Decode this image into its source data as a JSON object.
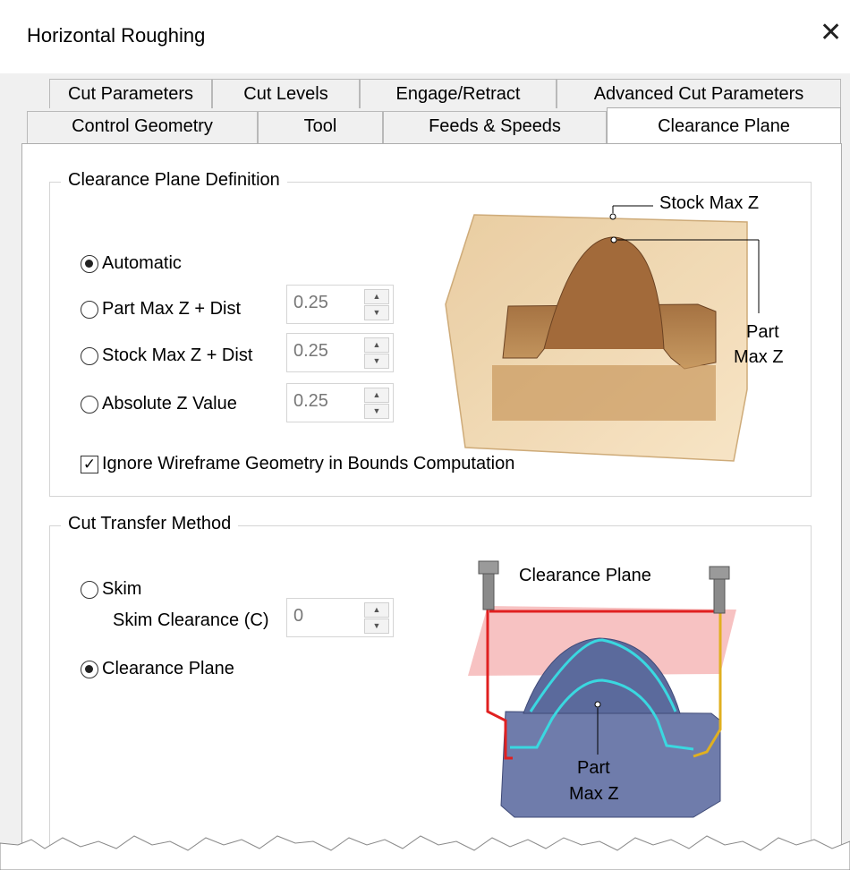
{
  "window": {
    "title": "Horizontal Roughing",
    "close_glyph": "✕"
  },
  "tabs": {
    "row1": [
      "Cut Parameters",
      "Cut Levels",
      "Engage/Retract",
      "Advanced Cut Parameters"
    ],
    "row2": [
      "Control Geometry",
      "Tool",
      "Feeds & Speeds",
      "Clearance Plane"
    ],
    "active": "Clearance Plane"
  },
  "clearance_plane_definition": {
    "group_label": "Clearance Plane Definition",
    "options": [
      {
        "label": "Automatic",
        "selected": true
      },
      {
        "label": "Part Max Z + Dist",
        "selected": false,
        "value": "0.25"
      },
      {
        "label": "Stock Max Z + Dist",
        "selected": false,
        "value": "0.25"
      },
      {
        "label": "Absolute Z Value",
        "selected": false,
        "value": "0.25"
      }
    ],
    "ignore_wireframe": {
      "label": "Ignore Wireframe Geometry in Bounds Computation",
      "checked": true
    },
    "diagram": {
      "stock_max_z": "Stock Max Z",
      "part_max_z_1": "Part",
      "part_max_z_2": "Max Z"
    }
  },
  "cut_transfer_method": {
    "group_label": "Cut Transfer Method",
    "skim": {
      "label": "Skim",
      "selected": false
    },
    "skim_clearance": {
      "label": "Skim Clearance (C)",
      "value": "0"
    },
    "clearance_plane": {
      "label": "Clearance Plane",
      "selected": true
    },
    "diagram": {
      "title": "Clearance Plane",
      "part_max_z_1": "Part",
      "part_max_z_2": "Max Z"
    }
  },
  "colors": {
    "stock": "#d9b480",
    "part": "#8a5a2e",
    "tool_path_red": "#e02020",
    "tool_path_cyan": "#3ad8e0",
    "tool_path_yellow": "#e0b020",
    "plane": "#f4a8a8",
    "part_blue": "#5b6a9c"
  }
}
